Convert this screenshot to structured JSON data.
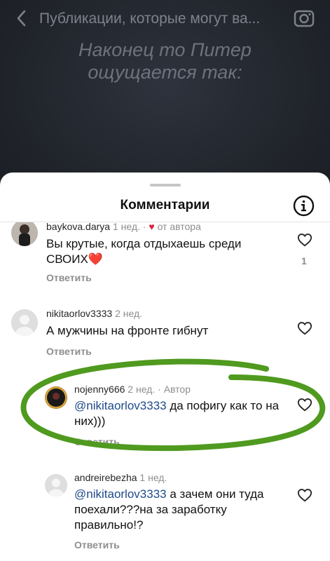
{
  "header": {
    "title": "Публикации, которые могут ва..."
  },
  "overlay": {
    "line1": "Наконец то Питер",
    "line2": "ощущается так:"
  },
  "sheet": {
    "title": "Комментарии"
  },
  "comments": [
    {
      "username": "baykova.darya",
      "time": "1 нед.",
      "author_badge": "от автора",
      "text": "Вы крутые, когда отдыхаешь среди СВОИХ",
      "emoji": "❤️",
      "reply": "Ответить",
      "likes": "1"
    },
    {
      "username": "nikitaorlov3333",
      "time": "2 нед.",
      "text": "А мужчины на фронте гибнут",
      "reply": "Ответить"
    },
    {
      "username": "nojenny666",
      "time": "2 нед.",
      "author_tag": "Автор",
      "mention": "@nikitaorlov3333",
      "text": " да пофигу как то на них)))",
      "reply": "Ответить"
    },
    {
      "username": "andreirebezha",
      "time": "1 нед.",
      "mention": "@nikitaorlov3333",
      "text": " а зачем они туда поехали???на за заработку правильно!?",
      "reply": "Ответить"
    }
  ],
  "colors": {
    "annotation": "#4f9a1f",
    "mention": "#1f4a8a",
    "like_red": "#e0213a"
  }
}
